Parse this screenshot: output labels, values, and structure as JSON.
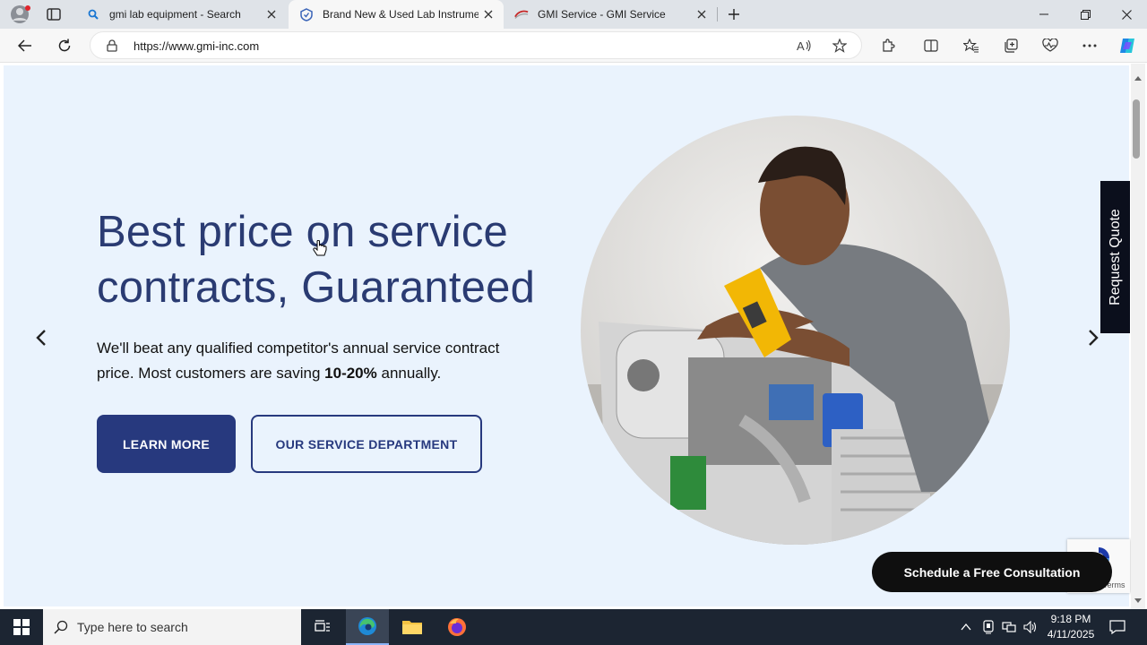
{
  "browser": {
    "tabs": [
      {
        "label": "gmi lab equipment - Search",
        "icon": "search-icon",
        "active": false
      },
      {
        "label": "Brand New & Used Lab Instrume",
        "icon": "shield-icon",
        "active": true
      },
      {
        "label": "GMI Service - GMI Service",
        "icon": "gmi-logo-icon",
        "active": false
      }
    ],
    "url": "https://www.gmi-inc.com"
  },
  "hero": {
    "headline_line1": "Best price on service",
    "headline_line2": "contracts, Guaranteed",
    "sub_part1": "We'll beat any qualified competitor's annual service contract price. Most customers are saving ",
    "sub_bold": "10-20%",
    "sub_part2": " annually.",
    "learn_more": "LEARN MORE",
    "service_dept": "OUR SERVICE DEPARTMENT"
  },
  "widgets": {
    "request_quote": "Request Quote",
    "schedule": "Schedule a Free Consultation",
    "recaptcha_terms": "Terms"
  },
  "taskbar": {
    "search_placeholder": "Type here to search",
    "time": "9:18 PM",
    "date": "4/11/2025"
  },
  "colors": {
    "brand_navy": "#27397e",
    "hero_bg": "#eaf3fd"
  }
}
